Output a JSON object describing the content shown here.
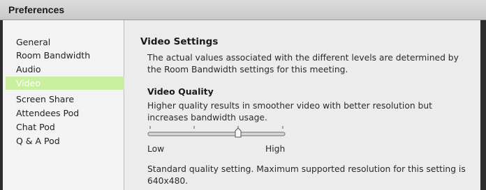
{
  "window": {
    "title": "Preferences"
  },
  "sidebar": {
    "items": [
      {
        "label": "General",
        "active": false
      },
      {
        "label": "Room Bandwidth",
        "active": false
      },
      {
        "label": "Audio",
        "active": false
      },
      {
        "label": "Video",
        "active": true
      },
      {
        "label": "Screen Share",
        "active": false
      },
      {
        "label": "Attendees Pod",
        "active": false
      },
      {
        "label": "Chat Pod",
        "active": false
      },
      {
        "label": "Q & A Pod",
        "active": false
      }
    ]
  },
  "content": {
    "heading": "Video Settings",
    "description": "The actual values associated with the different levels are determined by the Room Bandwidth settings for this meeting.",
    "quality": {
      "heading": "Video Quality",
      "description": "Higher quality results in smoother video with better resolution but increases bandwidth usage.",
      "slider": {
        "min_label": "Low",
        "max_label": "High",
        "levels": 4,
        "selected_level": 3
      },
      "status": "Standard quality setting. Maximum supported resolution for this setting is 640x480."
    }
  },
  "colors": {
    "active_item_bg": "#c8f09e"
  }
}
